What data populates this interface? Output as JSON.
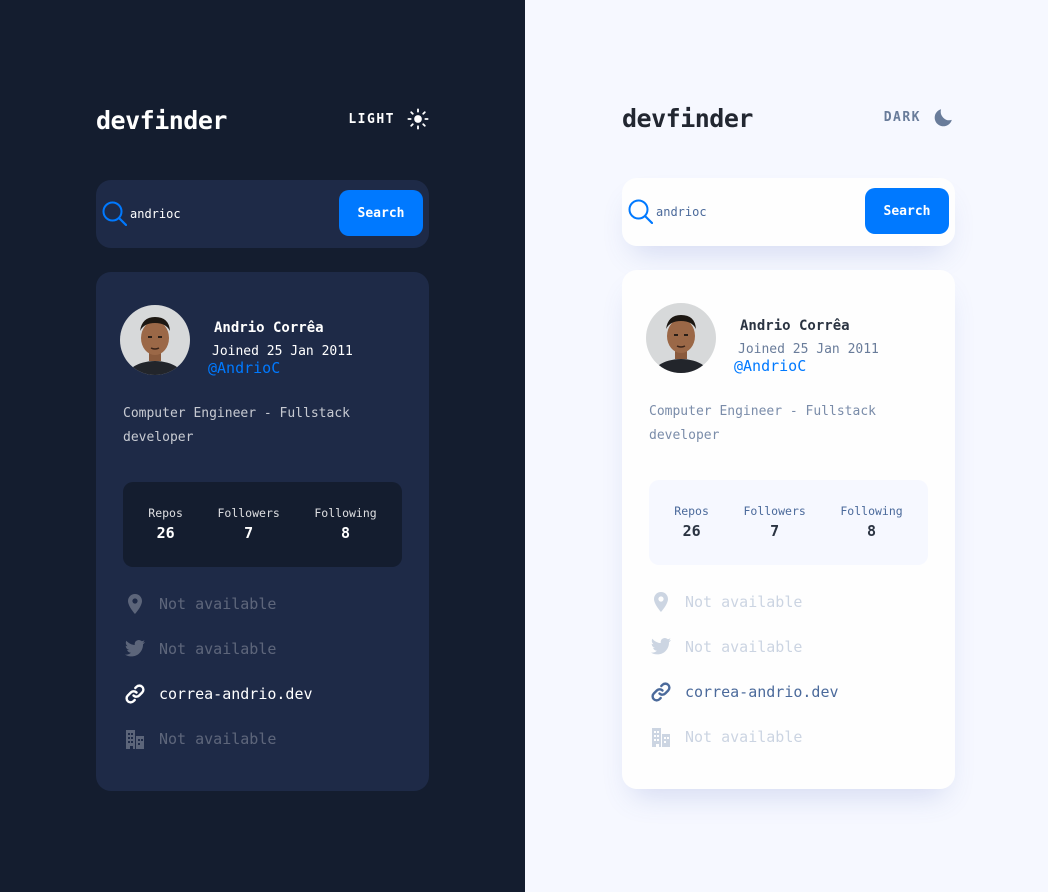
{
  "colors": {
    "accent": "#0079ff",
    "dark_bg": "#141d2f",
    "dark_card": "#1e2a47",
    "light_bg": "#f6f8ff",
    "light_card": "#fefefe"
  },
  "dark_mode": {
    "logo": "devfinder",
    "theme_toggle": {
      "label": "LIGHT",
      "icon": "sun-icon"
    },
    "search": {
      "value": "andrioc",
      "icon": "search-icon",
      "button_label": "Search"
    },
    "profile": {
      "name": "Andrio Corrêa",
      "joined": "Joined 25 Jan 2011",
      "login": "@AndrioC",
      "bio": "Computer Engineer - Fullstack developer",
      "stats": [
        {
          "label": "Repos",
          "value": "26"
        },
        {
          "label": "Followers",
          "value": "7"
        },
        {
          "label": "Following",
          "value": "8"
        }
      ],
      "links": [
        {
          "icon": "location-pin-icon",
          "text": "Not available"
        },
        {
          "icon": "twitter-icon",
          "text": "Not available"
        },
        {
          "icon": "link-icon",
          "text": "correa-andrio.dev"
        },
        {
          "icon": "company-building-icon",
          "text": "Not available"
        }
      ]
    }
  },
  "light_mode": {
    "logo": "devfinder",
    "theme_toggle": {
      "label": "DARK",
      "icon": "moon-icon"
    },
    "search": {
      "value": "andrioc",
      "icon": "search-icon",
      "button_label": "Search"
    },
    "profile": {
      "name": "Andrio Corrêa",
      "joined": "Joined 25 Jan 2011",
      "login": "@AndrioC",
      "bio": "Computer Engineer - Fullstack developer",
      "stats": [
        {
          "label": "Repos",
          "value": "26"
        },
        {
          "label": "Followers",
          "value": "7"
        },
        {
          "label": "Following",
          "value": "8"
        }
      ],
      "links": [
        {
          "icon": "location-pin-icon",
          "text": "Not available"
        },
        {
          "icon": "twitter-icon",
          "text": "Not available"
        },
        {
          "icon": "link-icon",
          "text": "correa-andrio.dev"
        },
        {
          "icon": "company-building-icon",
          "text": "Not available"
        }
      ]
    }
  }
}
